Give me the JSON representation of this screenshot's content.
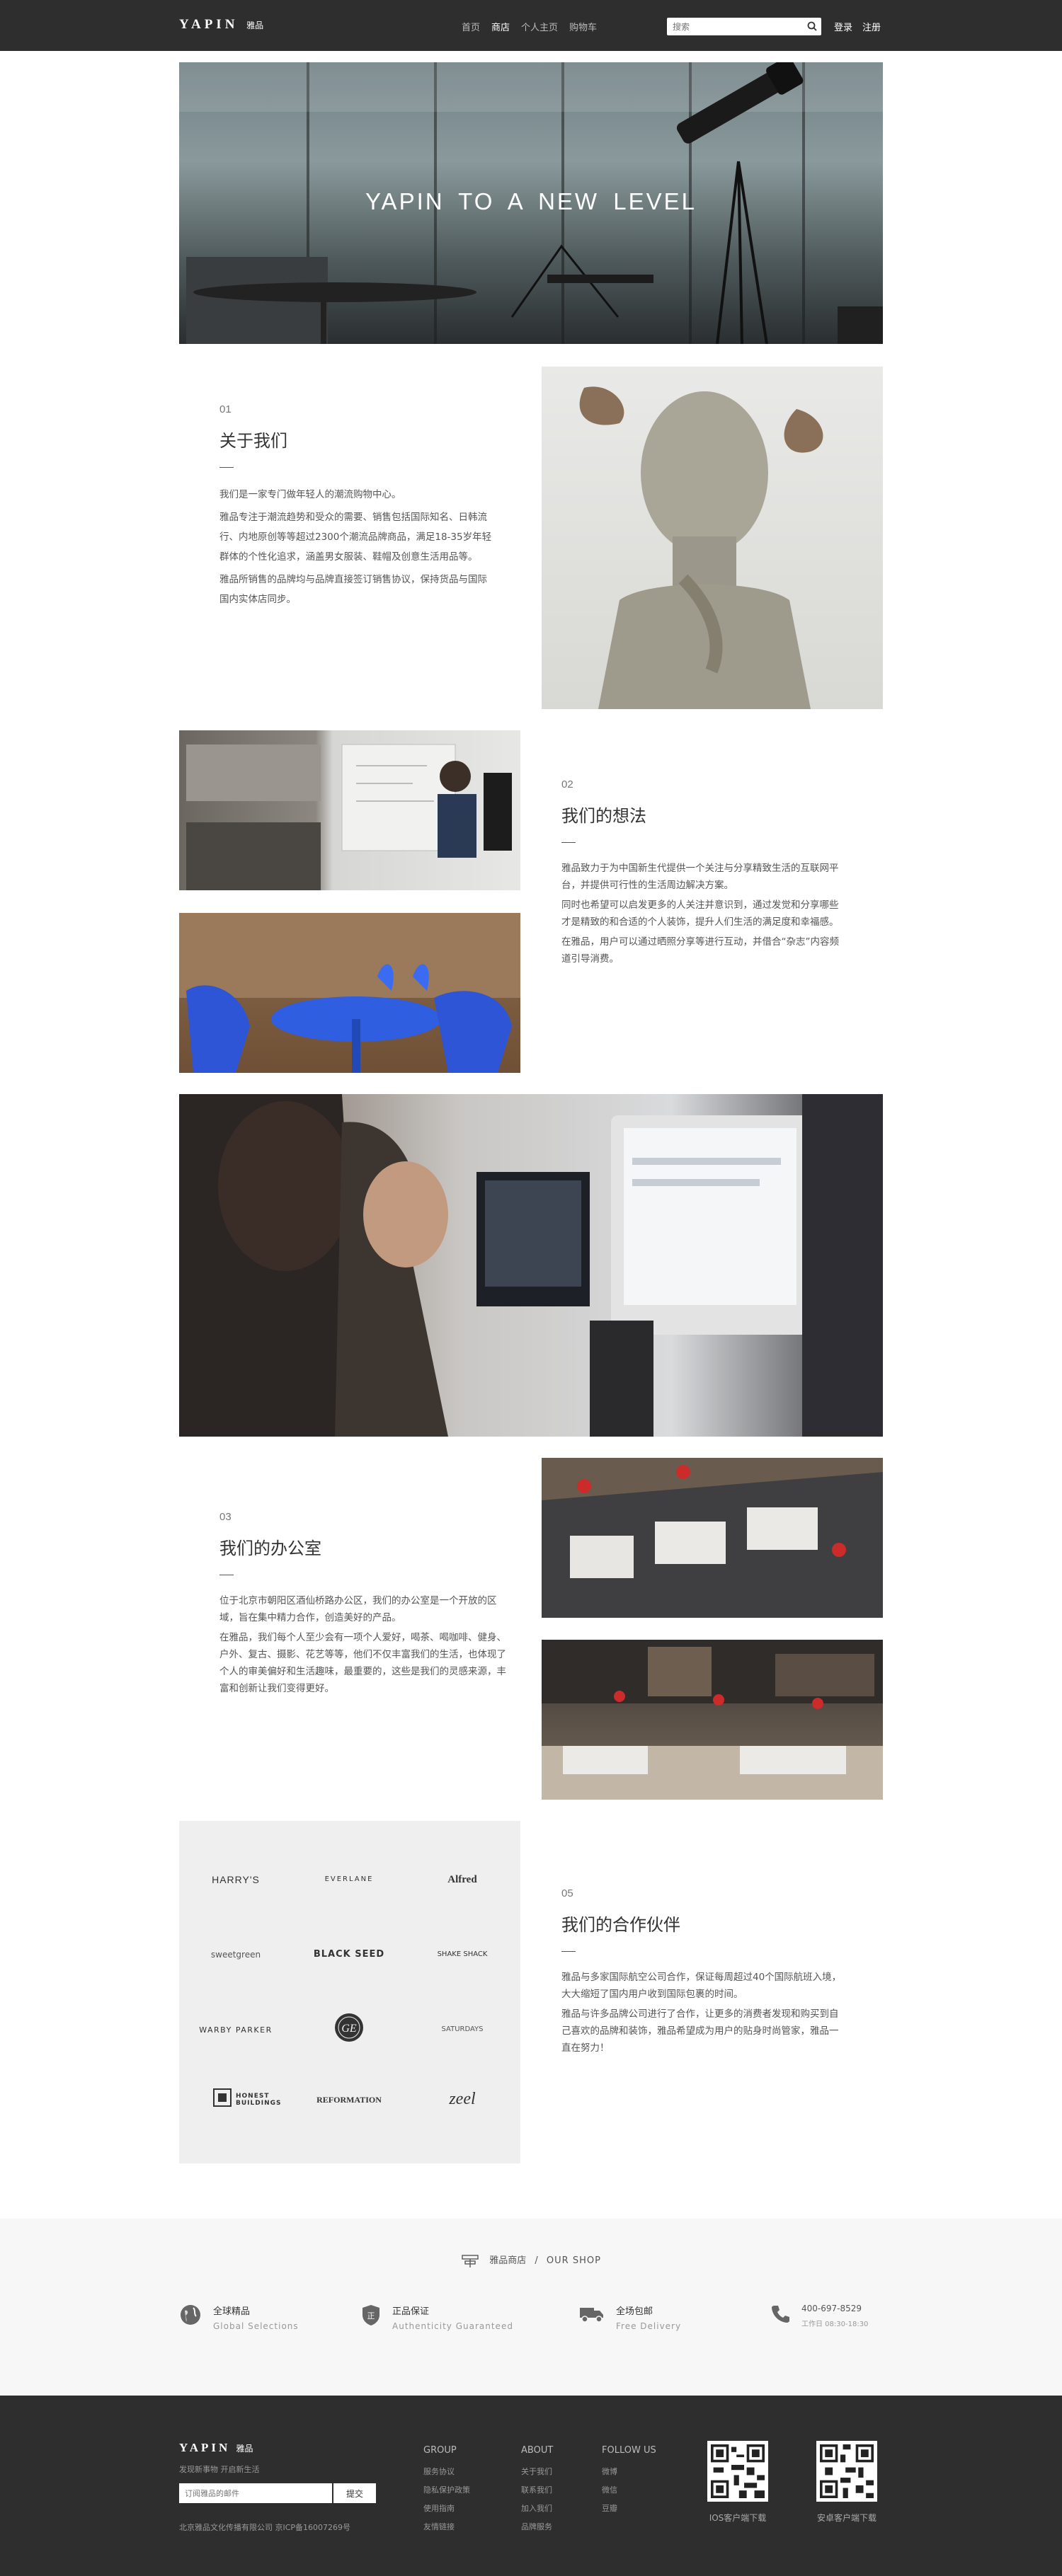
{
  "header": {
    "logo": "YAPIN",
    "logo_cn": "雅品",
    "nav": [
      "首页",
      "商店",
      "个人主页",
      "购物车"
    ],
    "active_nav": "商店",
    "search_placeholder": "搜索",
    "login": "登录",
    "register": "注册"
  },
  "hero": {
    "title": "YAPIN TO A NEW LEVEL"
  },
  "sections": {
    "about": {
      "num": "01",
      "title": "关于我们",
      "paragraphs": [
        "我们是一家专门做年轻人的潮流购物中心。",
        "雅品专注于潮流趋势和受众的需要、销售包括国际知名、日韩流行、内地原创等等超过2300个潮流品牌商品，满足18-35岁年轻群体的个性化追求，涵盖男女服装、鞋帽及创意生活用品等。",
        "雅品所销售的品牌均与品牌直接签订销售协议，保持货品与国际国内实体店同步。"
      ]
    },
    "idea": {
      "num": "02",
      "title": "我们的想法",
      "paragraphs": [
        "雅品致力于为中国新生代提供一个关注与分享精致生活的互联网平台，并提供可行性的生活周边解决方案。",
        "同时也希望可以启发更多的人关注并意识到，通过发觉和分享哪些才是精致的和合适的个人装饰，提升人们生活的满足度和幸福感。",
        "在雅品，用户可以通过晒照分享等进行互动，并借合“杂志”内容频道引导消费。"
      ]
    },
    "office": {
      "num": "03",
      "title": "我们的办公室",
      "paragraphs": [
        "位于北京市朝阳区酒仙桥路办公区，我们的办公室是一个开放的区域，旨在集中精力合作，创造美好的产品。",
        "在雅品，我们每个人至少会有一项个人爱好，喝茶、喝咖啡、健身、户外、复古、摄影、花艺等等，他们不仅丰富我们的生活，也体现了个人的审美偏好和生活趣味，最重要的，这些是我们的灵感来源，丰富和创新让我们变得更好。"
      ]
    },
    "partners": {
      "num": "05",
      "title": "我们的合作伙伴",
      "paragraphs": [
        "雅品与多家国际航空公司合作，保证每周超过40个国际航班入境，大大缩短了国内用户收到国际包裹的时间。",
        "雅品与许多品牌公司进行了合作，让更多的消费者发现和购买到自己喜欢的品牌和装饰，雅品希望成为用户的贴身时尚管家，雅品一直在努力！"
      ],
      "logos": [
        "HARRY'S",
        "EVERLANE",
        "Alfred",
        "sweetgreen",
        "BLACK SEED",
        "SHAKE SHACK",
        "WARBY PARKER",
        "GE",
        "SATURDAYS",
        "HONEST BUILDINGS",
        "REFORMATION",
        "zeel"
      ]
    }
  },
  "shop": {
    "brand": "雅品商店",
    "sep": "/",
    "en": "OUR SHOP",
    "features": [
      {
        "title": "全球精品",
        "sub": "Global Selections",
        "icon": "globe-icon"
      },
      {
        "title": "正品保证",
        "sub": "Authenticity Guaranteed",
        "icon": "shield-icon"
      },
      {
        "title": "全场包邮",
        "sub": "Free Delivery",
        "icon": "truck-icon"
      },
      {
        "title": "400-697-8529",
        "sub": "工作日 08:30-18:30",
        "icon": "phone-icon"
      }
    ]
  },
  "footer": {
    "logo": "YAPIN",
    "logo_cn": "雅品",
    "tagline": "发现新事物  开启新生活",
    "subscribe_placeholder": "订阅雅品的邮件",
    "subscribe_button": "提交",
    "copyright": "北京雅品文化传播有限公司    京ICP备16007269号",
    "columns": [
      {
        "title": "GROUP",
        "items": [
          "服务协议",
          "隐私保护政策",
          "使用指南",
          "友情链接"
        ]
      },
      {
        "title": "ABOUT",
        "items": [
          "关于我们",
          "联系我们",
          "加入我们",
          "品牌服务"
        ]
      },
      {
        "title": "FOLLOW US",
        "items": [
          "微博",
          "微信",
          "豆瓣"
        ]
      }
    ],
    "qr": [
      "IOS客户端下载",
      "安卓客户端下载"
    ]
  }
}
